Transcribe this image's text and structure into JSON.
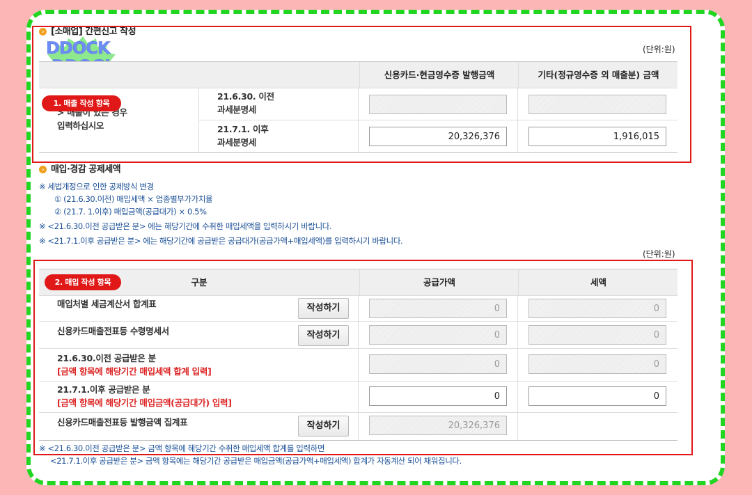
{
  "section1": {
    "title": "[소매업] 간편신고 작성",
    "unit": "(단위:원)",
    "headers": [
      "신용카드·현금영수증 발행금액",
      "기타(정규영수증 외 매출분) 금액"
    ],
    "label_tag": "1. 매출 작성 항목",
    "row_label_line1": "> 매출이 있는 경우",
    "row_label_line2": "입력하십시오",
    "rows": [
      {
        "label1": "21.6.30. 이전",
        "label2": "과세분명세",
        "v1": "",
        "v2": ""
      },
      {
        "label1": "21.7.1. 이후",
        "label2": "과세분명세",
        "v1": "20,326,376",
        "v2": "1,916,015"
      }
    ]
  },
  "logo": {
    "line1": "DDOCK",
    "line2": "DDOGI"
  },
  "section2": {
    "title": "매입·경감 공제세액",
    "notes": [
      "※ 세법개정으로 인한 공제방식 변경",
      "① (21.6.30.이전) 매입세액 × 업종별부가가치율",
      "② (21.7. 1.이후) 매입금액(공급대가) × 0.5%",
      "※ <21.6.30.이전 공급받은 분> 에는 해당기간에 수취한 매입세액을 입력하시기 바랍니다.",
      "※ <21.7.1.이후 공급받은 분> 에는 해당기간에 공급받은 공급대가(공급가액+매입세액)를 입력하시기 바랍니다."
    ],
    "unit": "(단위:원)",
    "label_tag": "2. 매입 작성 항목",
    "headers": [
      "구분",
      "공급가액",
      "세액"
    ],
    "button_label": "작성하기",
    "rows": [
      {
        "label": "매입처별 세금계산서 합계표",
        "sub": "",
        "v1": "0",
        "v2": "0"
      },
      {
        "label": "신용카드매출전표등 수령명세서",
        "sub": "",
        "v1": "0",
        "v2": "0"
      },
      {
        "label": "21.6.30.이전 공급받은 분",
        "sub": "[금액 항목에 해당기간 매입세액 합계 입력]",
        "v1": "0",
        "v2": "0"
      },
      {
        "label": "21.7.1.이후 공급받은 분",
        "sub": "[금액 항목에 해당기간 매입금액(공급대가) 입력]",
        "v1": "0",
        "v2": "0"
      },
      {
        "label": "신용카드매출전표등 발행금액 집계표",
        "sub": "",
        "v1": "20,326,376",
        "v2": ""
      }
    ],
    "footer_notes": [
      "※ <21.6.30.이전 공급받은 분> 금액 항목에 해당기간 수취한 매입세액 합계를 입력하면",
      "<21.7.1.이후 공급받은 분> 금액 항목에는 해당기간 공급받은 매입금액(공급가액+매입세액) 합계가 자동계산 되어 채워집니다."
    ]
  },
  "colors": {
    "background": "#fdb6b6",
    "dashed_border": "#21d621",
    "highlight": "#e01818",
    "note_text": "#1a4f96"
  }
}
